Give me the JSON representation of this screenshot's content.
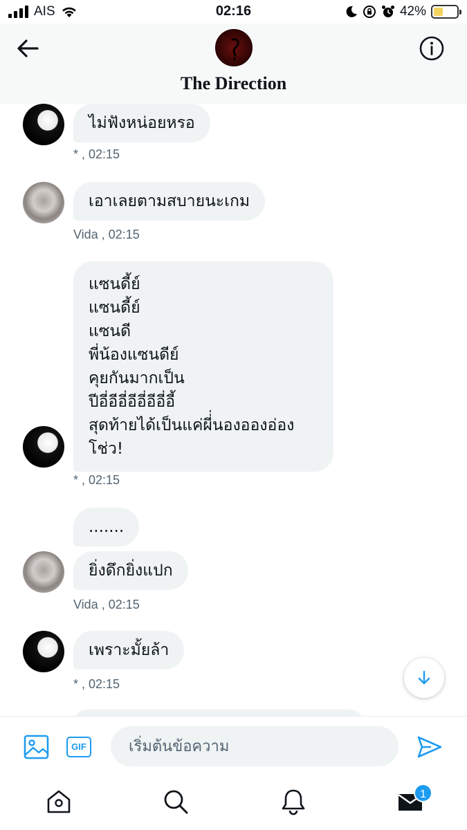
{
  "status_bar": {
    "carrier": "AIS",
    "time": "02:16",
    "battery_percent": "42%",
    "battery_level": 0.42,
    "icons": [
      "signal-icon",
      "wifi-icon",
      "moon-icon",
      "rotation-lock-icon",
      "alarm-icon",
      "battery-charging-icon"
    ]
  },
  "header": {
    "title": "The Direction",
    "icons": [
      "back-arrow-icon",
      "info-icon"
    ]
  },
  "messages": [
    {
      "text": "ไม่ฟังหน่อยหรอ",
      "sender": "*",
      "time": " , 02:15",
      "meta": "* , 02:15"
    },
    {
      "text": "เอาเลยตามสบายนะเกม",
      "sender": "Vida",
      "meta": "Vida  , 02:15"
    },
    {
      "text": "แซนดี้ย์\nแซนดี้ย์\nแซนดี\nพี่น้องแซนดีย์\nคุยกันมากเป็น\nปีอี่อีอี่อีอี่อีอี่อี้\nสุดท้ายได้เป็นแค่ผี่่นองอองอ่อง\nโช่ว!",
      "meta": "* , 02:15"
    },
    {
      "text": ".......",
      "meta": ""
    },
    {
      "text": "ยิ่งดึกยิ่งแปก",
      "meta": "Vida  , 02:15"
    },
    {
      "text": "เพราะมั้ยล้า",
      "meta": "* , 02:15"
    }
  ],
  "composer": {
    "placeholder": "เริ่มต้นข้อความ",
    "gif_label": "GIF",
    "icons": [
      "image-icon",
      "send-icon"
    ]
  },
  "tabbar": {
    "icons": [
      "home-icon",
      "search-icon",
      "notifications-bell-icon",
      "messages-envelope-icon"
    ],
    "messages_badge": "1"
  },
  "colors": {
    "accent": "#1d9bf0",
    "bubble": "#eff3f4",
    "meta_text": "#536471"
  }
}
